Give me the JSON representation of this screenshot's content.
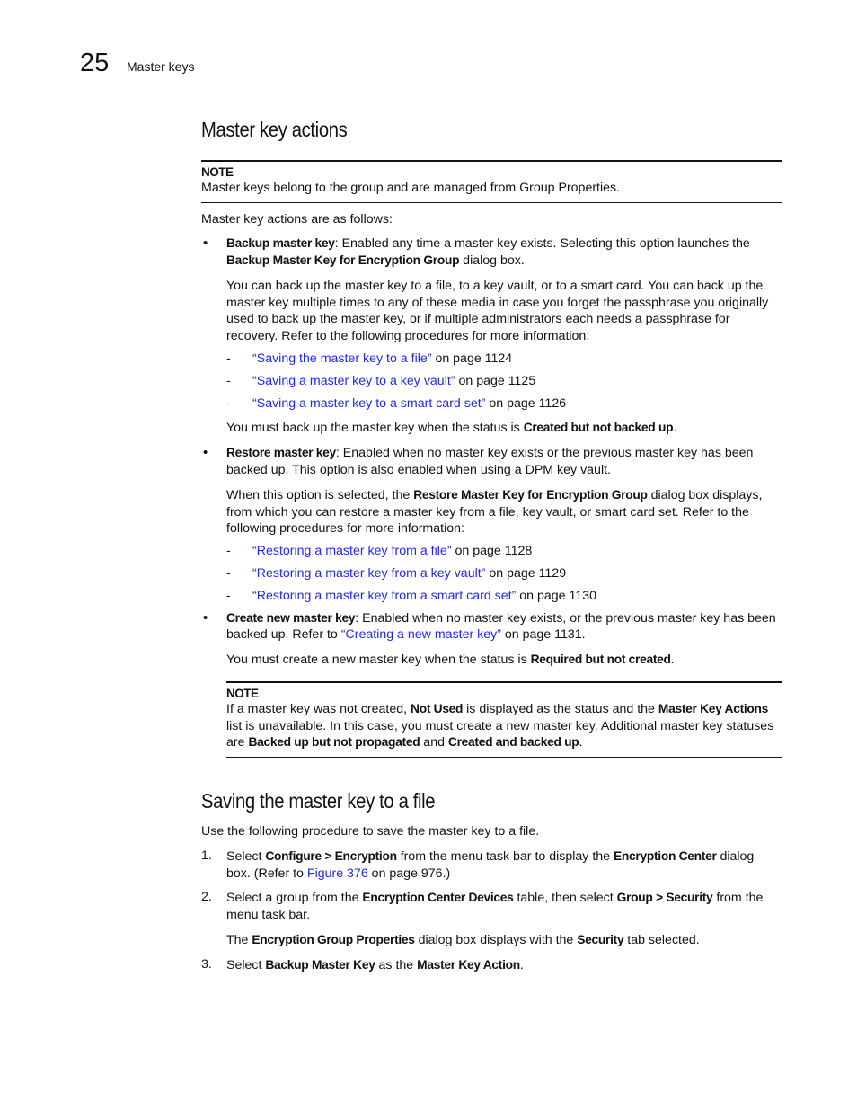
{
  "header": {
    "chapter_number": "25",
    "chapter_title": "Master keys"
  },
  "section1": {
    "title": "Master key actions",
    "note": {
      "label": "NOTE",
      "text": "Master keys belong to the group and are managed from Group Properties."
    },
    "intro": "Master key actions are as follows:",
    "backup": {
      "term": "Backup master key",
      "text1": ": Enabled any time a master key exists. Selecting this option launches the ",
      "dialog": "Backup Master Key for Encryption Group",
      "text2": " dialog box.",
      "para": "You can back up the master key to a file, to a key vault, or to a smart card. You can back up the master key multiple times to any of these media in case you forget the passphrase you originally used to back up the master key, or if multiple administrators each needs a passphrase for recovery. Refer to the following procedures for more information:",
      "links": [
        {
          "link": "“Saving the master key to a file”",
          "page": " on page 1124"
        },
        {
          "link": "“Saving a master key to a key vault”",
          "page": " on page 1125"
        },
        {
          "link": "“Saving a master key to a smart card set”",
          "page": " on page 1126"
        }
      ],
      "status_pre": "You must back up the master key when the status is ",
      "status": "Created but not backed up",
      "status_post": "."
    },
    "restore": {
      "term": "Restore master key",
      "text1": ": Enabled when no master key exists or the previous master key has been backed up. This option is also enabled when using a DPM key vault.",
      "para_pre": "When this option is selected, the ",
      "dialog": "Restore Master Key for Encryption Group",
      "para_post": " dialog box displays, from which you can restore a master key from a file, key vault, or smart card set. Refer to the following procedures for more information:",
      "links": [
        {
          "link": "“Restoring a master key from a file”",
          "page": " on page 1128"
        },
        {
          "link": "“Restoring a master key from a key vault”",
          "page": " on page 1129"
        },
        {
          "link": "“Restoring a master key from a smart card set”",
          "page": " on page 1130"
        }
      ]
    },
    "create": {
      "term": "Create new master key",
      "text1": ": Enabled when no master key exists, or the previous master key has been backed up. Refer to ",
      "link": "“Creating a new master key”",
      "text2": " on page 1131.",
      "status_pre": "You must create a new master key when the status is ",
      "status": "Required but not created",
      "status_post": ".",
      "note": {
        "label": "NOTE",
        "t1": "If a master key was not created, ",
        "b1": "Not Used",
        "t2": " is displayed as the status and the ",
        "b2": "Master Key Actions",
        "t3": " list is unavailable. In this case, you must create a new master key. Additional master key statuses are ",
        "b3": "Backed up but not propagated",
        "t4": " and ",
        "b4": "Created and backed up",
        "t5": "."
      }
    }
  },
  "section2": {
    "title": "Saving the master key to a file",
    "intro": "Use the following procedure to save the master key to a file.",
    "steps": [
      {
        "num": "1.",
        "t1": "Select ",
        "b1": "Configure > Encryption",
        "t2": " from the menu task bar to display the ",
        "b2": "Encryption Center",
        "t3": " dialog box. (Refer to ",
        "link": "Figure 376",
        "t4": " on page 976.)"
      },
      {
        "num": "2.",
        "t1": "Select a group from the ",
        "b1": "Encryption Center Devices",
        "t2": " table, then select ",
        "b2": "Group > Security",
        "t3": " from the menu task bar.",
        "sub_t1": "The ",
        "sub_b1": "Encryption Group Properties",
        "sub_t2": " dialog box displays with the ",
        "sub_b2": "Security",
        "sub_t3": " tab selected."
      },
      {
        "num": "3.",
        "t1": "Select ",
        "b1": "Backup Master Key",
        "t2": " as the ",
        "b2": "Master Key Action",
        "t3": "."
      }
    ]
  }
}
